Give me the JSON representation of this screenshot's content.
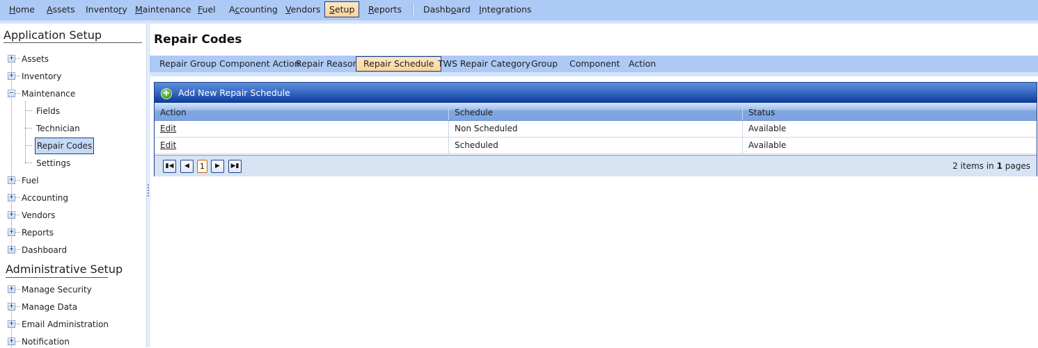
{
  "topmenu": {
    "items": [
      {
        "label": "Home",
        "accesskey_index": 0
      },
      {
        "label": "Assets",
        "accesskey_index": 0
      },
      {
        "label": "Inventory",
        "accesskey_index": 7
      },
      {
        "label": "Maintenance",
        "accesskey_index": 0
      },
      {
        "label": "Fuel",
        "accesskey_index": 0
      },
      {
        "label": "Accounting",
        "accesskey_index": 1
      },
      {
        "label": "Vendors",
        "accesskey_index": 0
      },
      {
        "label": "Setup",
        "accesskey_index": 0,
        "active": true
      },
      {
        "label": "Reports",
        "accesskey_index": 0
      },
      {
        "label": "Dashboard",
        "accesskey_index": 5
      },
      {
        "label": "Integrations",
        "accesskey_index": 0
      }
    ]
  },
  "sidebar": {
    "application_setup": {
      "title": "Application Setup",
      "items": [
        {
          "label": "Assets",
          "expander": "+"
        },
        {
          "label": "Inventory",
          "expander": "+"
        },
        {
          "label": "Maintenance",
          "expander": "−",
          "children": [
            {
              "label": "Fields"
            },
            {
              "label": "Technician"
            },
            {
              "label": "Repair Codes",
              "selected": true
            },
            {
              "label": "Settings"
            }
          ]
        },
        {
          "label": "Fuel",
          "expander": "+"
        },
        {
          "label": "Accounting",
          "expander": "+"
        },
        {
          "label": "Vendors",
          "expander": "+"
        },
        {
          "label": "Reports",
          "expander": "+"
        },
        {
          "label": "Dashboard",
          "expander": "+"
        }
      ]
    },
    "administrative_setup": {
      "title": "Administrative Setup",
      "items": [
        {
          "label": "Manage Security",
          "expander": "+"
        },
        {
          "label": "Manage Data",
          "expander": "+"
        },
        {
          "label": "Email Administration",
          "expander": "+"
        },
        {
          "label": "Notification",
          "expander": "+"
        }
      ]
    }
  },
  "main": {
    "title": "Repair Codes",
    "tabs": [
      {
        "label": "Repair Group Component Action"
      },
      {
        "label": "Repair Reason"
      },
      {
        "label": "Repair Schedule",
        "active": true
      },
      {
        "label": "TWS Repair Category"
      },
      {
        "label": "Group"
      },
      {
        "label": "Component"
      },
      {
        "label": "Action"
      }
    ],
    "grid": {
      "add_label": "Add New Repair Schedule",
      "add_icon": "plus-circle-icon",
      "columns": [
        "Action",
        "Schedule",
        "Status"
      ],
      "rows": [
        {
          "action": "Edit",
          "schedule": "Non Scheduled",
          "status": "Available"
        },
        {
          "action": "Edit",
          "schedule": "Scheduled",
          "status": "Available"
        }
      ],
      "pager": {
        "first_icon": "⏮",
        "prev_icon": "◀",
        "current_page": "1",
        "next_icon": "▶",
        "last_icon": "⏭",
        "info_prefix": "2 items in ",
        "info_pages": "1",
        "info_suffix": " pages"
      }
    }
  },
  "colors": {
    "menu_bg": "#adc9f5",
    "active_tab_bg": "#fbd59a",
    "grid_toolbar": "#1c4ba9",
    "grid_header": "#80a6e0",
    "pager_bg": "#d6e4f3"
  }
}
